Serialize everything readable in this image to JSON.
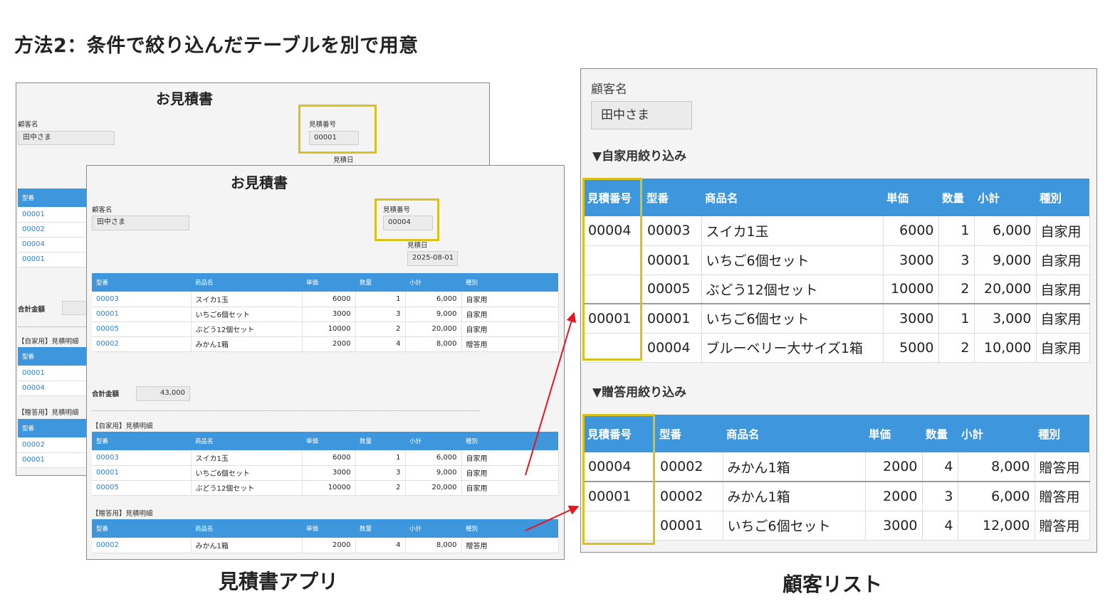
{
  "title": "方法2：条件で絞り込んだテーブルを別で用意",
  "captions": {
    "app": "見積書アプリ",
    "list": "顧客リスト"
  },
  "colors": {
    "header_blue": "#3e96dc",
    "highlight": "#d8c21e",
    "arrow": "#e8141e",
    "link": "#2f7fd0"
  },
  "back_form": {
    "title": "お見積書",
    "customer_label": "顧客名",
    "customer": "田中さま",
    "est_no_label": "見積番号",
    "est_no": "00001",
    "date_label": "見積日",
    "table1": {
      "header": "型番",
      "rows": [
        "00001",
        "00002",
        "00004",
        "00001"
      ]
    },
    "total_label": "合計金額",
    "self_label": "【自家用】見積明細",
    "table2": {
      "header": "型番",
      "rows": [
        "00001",
        "00004"
      ]
    },
    "gift_label": "【贈答用】見積明細",
    "table3": {
      "header": "型番",
      "rows": [
        "00002",
        "00001"
      ]
    }
  },
  "front_form": {
    "title": "お見積書",
    "customer_label": "顧客名",
    "customer": "田中さま",
    "est_no_label": "見積番号",
    "est_no": "00004",
    "date_label": "見積日",
    "date": "2025-08-01",
    "headers": [
      "型番",
      "商品名",
      "単価",
      "数量",
      "小計",
      "種別"
    ],
    "items": [
      [
        "00003",
        "スイカ1玉",
        "6000",
        "1",
        "6,000",
        "自家用"
      ],
      [
        "00001",
        "いちご6個セット",
        "3000",
        "3",
        "9,000",
        "自家用"
      ],
      [
        "00005",
        "ぶどう12個セット",
        "10000",
        "2",
        "20,000",
        "自家用"
      ],
      [
        "00002",
        "みかん1箱",
        "2000",
        "4",
        "8,000",
        "贈答用"
      ]
    ],
    "total_label": "合計金額",
    "total": "43,000",
    "self_label": "【自家用】見積明細",
    "self_items": [
      [
        "00003",
        "スイカ1玉",
        "6000",
        "1",
        "6,000",
        "自家用"
      ],
      [
        "00001",
        "いちご6個セット",
        "3000",
        "3",
        "9,000",
        "自家用"
      ],
      [
        "00005",
        "ぶどう12個セット",
        "10000",
        "2",
        "20,000",
        "自家用"
      ]
    ],
    "gift_label": "【贈答用】見積明細",
    "gift_items": [
      [
        "00002",
        "みかん1箱",
        "2000",
        "4",
        "8,000",
        "贈答用"
      ]
    ]
  },
  "customer_list": {
    "customer_label": "顧客名",
    "customer": "田中さま",
    "self_section": "▼自家用絞り込み",
    "gift_section": "▼贈答用絞り込み",
    "headers": [
      "見積番号",
      "型番",
      "商品名",
      "単価",
      "数量",
      "小計",
      "種別"
    ],
    "self_rows": [
      [
        "00004",
        "00003",
        "スイカ1玉",
        "6000",
        "1",
        "6,000",
        "自家用"
      ],
      [
        "",
        "00001",
        "いちご6個セット",
        "3000",
        "3",
        "9,000",
        "自家用"
      ],
      [
        "",
        "00005",
        "ぶどう12個セット",
        "10000",
        "2",
        "20,000",
        "自家用"
      ],
      [
        "00001",
        "00001",
        "いちご6個セット",
        "3000",
        "1",
        "3,000",
        "自家用"
      ],
      [
        "",
        "00004",
        "ブルーベリー大サイズ1箱",
        "5000",
        "2",
        "10,000",
        "自家用"
      ]
    ],
    "gift_rows": [
      [
        "00004",
        "00002",
        "みかん1箱",
        "2000",
        "4",
        "8,000",
        "贈答用"
      ],
      [
        "00001",
        "00002",
        "みかん1箱",
        "2000",
        "3",
        "6,000",
        "贈答用"
      ],
      [
        "",
        "00001",
        "いちご6個セット",
        "3000",
        "4",
        "12,000",
        "贈答用"
      ]
    ]
  }
}
